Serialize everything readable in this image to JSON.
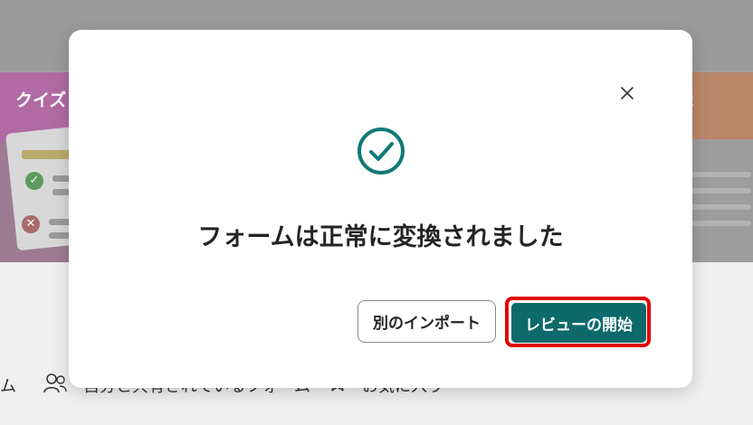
{
  "background": {
    "left_card": {
      "title": "クイズ"
    },
    "right_card": {
      "title": "録"
    },
    "bottom_nav": {
      "item_forms_partial": "ム",
      "item_shared_partial": "自分と共有されているフォーム",
      "item_favorites_partial": "お気に入り"
    }
  },
  "dialog": {
    "message": "フォームは正常に変換されました",
    "secondary_button": "別のインポート",
    "primary_button": "レビューの開始"
  },
  "colors": {
    "accent": "#0c6a6a",
    "highlight": "#e10000",
    "check": "#117a76"
  },
  "icons": {
    "close": "close-icon",
    "success": "check-circle-icon",
    "people": "people-icon",
    "star": "star-icon"
  }
}
